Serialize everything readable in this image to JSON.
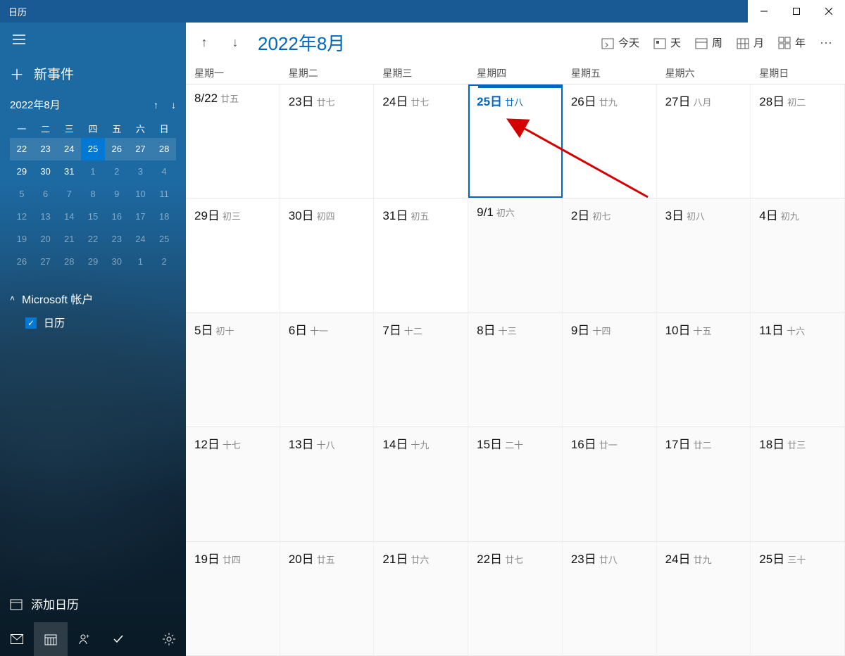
{
  "app": {
    "title": "日历"
  },
  "window_buttons": {
    "min": "—",
    "max": "▢",
    "close": "✕"
  },
  "sidebar": {
    "new_event": "新事件",
    "mini": {
      "title": "2022年8月",
      "dayheaders": [
        "一",
        "二",
        "三",
        "四",
        "五",
        "六",
        "日"
      ],
      "weeks": [
        [
          {
            "n": "22",
            "cw": true
          },
          {
            "n": "23",
            "cw": true
          },
          {
            "n": "24",
            "cw": true
          },
          {
            "n": "25",
            "sel": true,
            "cw": true
          },
          {
            "n": "26",
            "cw": true
          },
          {
            "n": "27",
            "cw": true
          },
          {
            "n": "28",
            "cw": true
          }
        ],
        [
          {
            "n": "29"
          },
          {
            "n": "30"
          },
          {
            "n": "31"
          },
          {
            "n": "1",
            "dim": true
          },
          {
            "n": "2",
            "dim": true
          },
          {
            "n": "3",
            "dim": true
          },
          {
            "n": "4",
            "dim": true
          }
        ],
        [
          {
            "n": "5",
            "dim": true
          },
          {
            "n": "6",
            "dim": true
          },
          {
            "n": "7",
            "dim": true
          },
          {
            "n": "8",
            "dim": true
          },
          {
            "n": "9",
            "dim": true
          },
          {
            "n": "10",
            "dim": true
          },
          {
            "n": "11",
            "dim": true
          }
        ],
        [
          {
            "n": "12",
            "dim": true
          },
          {
            "n": "13",
            "dim": true
          },
          {
            "n": "14",
            "dim": true
          },
          {
            "n": "15",
            "dim": true
          },
          {
            "n": "16",
            "dim": true
          },
          {
            "n": "17",
            "dim": true
          },
          {
            "n": "18",
            "dim": true
          }
        ],
        [
          {
            "n": "19",
            "dim": true
          },
          {
            "n": "20",
            "dim": true
          },
          {
            "n": "21",
            "dim": true
          },
          {
            "n": "22",
            "dim": true
          },
          {
            "n": "23",
            "dim": true
          },
          {
            "n": "24",
            "dim": true
          },
          {
            "n": "25",
            "dim": true
          }
        ],
        [
          {
            "n": "26",
            "dim": true
          },
          {
            "n": "27",
            "dim": true
          },
          {
            "n": "28",
            "dim": true
          },
          {
            "n": "29",
            "dim": true
          },
          {
            "n": "30",
            "dim": true
          },
          {
            "n": "1",
            "dim": true
          },
          {
            "n": "2",
            "dim": true
          }
        ]
      ]
    },
    "account_label": "Microsoft 帐户",
    "calendar_item": "日历",
    "add_calendar": "添加日历"
  },
  "toolbar": {
    "prev": "↑",
    "next": "↓",
    "title": "2022年8月",
    "today": "今天",
    "day": "天",
    "week": "周",
    "month": "月",
    "year": "年",
    "more": "···"
  },
  "dayheaders": [
    "星期一",
    "星期二",
    "星期三",
    "星期四",
    "星期五",
    "星期六",
    "星期日"
  ],
  "rows": [
    [
      {
        "d": "8/22",
        "l": "廿五"
      },
      {
        "d": "23日",
        "l": "廿七"
      },
      {
        "d": "24日",
        "l": "廿七"
      },
      {
        "d": "25日",
        "l": "廿八",
        "today": true
      },
      {
        "d": "26日",
        "l": "廿九"
      },
      {
        "d": "27日",
        "l": "八月"
      },
      {
        "d": "28日",
        "l": "初二"
      }
    ],
    [
      {
        "d": "29日",
        "l": "初三"
      },
      {
        "d": "30日",
        "l": "初四"
      },
      {
        "d": "31日",
        "l": "初五"
      },
      {
        "d": "9/1",
        "l": "初六",
        "nm": true
      },
      {
        "d": "2日",
        "l": "初七",
        "nm": true
      },
      {
        "d": "3日",
        "l": "初八",
        "nm": true
      },
      {
        "d": "4日",
        "l": "初九",
        "nm": true
      }
    ],
    [
      {
        "d": "5日",
        "l": "初十",
        "nm": true
      },
      {
        "d": "6日",
        "l": "十一",
        "nm": true
      },
      {
        "d": "7日",
        "l": "十二",
        "nm": true
      },
      {
        "d": "8日",
        "l": "十三",
        "nm": true
      },
      {
        "d": "9日",
        "l": "十四",
        "nm": true
      },
      {
        "d": "10日",
        "l": "十五",
        "nm": true
      },
      {
        "d": "11日",
        "l": "十六",
        "nm": true
      }
    ],
    [
      {
        "d": "12日",
        "l": "十七",
        "nm": true
      },
      {
        "d": "13日",
        "l": "十八",
        "nm": true
      },
      {
        "d": "14日",
        "l": "十九",
        "nm": true
      },
      {
        "d": "15日",
        "l": "二十",
        "nm": true
      },
      {
        "d": "16日",
        "l": "廿一",
        "nm": true
      },
      {
        "d": "17日",
        "l": "廿二",
        "nm": true
      },
      {
        "d": "18日",
        "l": "廿三",
        "nm": true
      }
    ],
    [
      {
        "d": "19日",
        "l": "廿四",
        "nm": true
      },
      {
        "d": "20日",
        "l": "廿五",
        "nm": true
      },
      {
        "d": "21日",
        "l": "廿六",
        "nm": true
      },
      {
        "d": "22日",
        "l": "廿七",
        "nm": true
      },
      {
        "d": "23日",
        "l": "廿八",
        "nm": true
      },
      {
        "d": "24日",
        "l": "廿九",
        "nm": true
      },
      {
        "d": "25日",
        "l": "三十",
        "nm": true
      }
    ]
  ],
  "annotation": {
    "arrow_color": "#d40000"
  }
}
